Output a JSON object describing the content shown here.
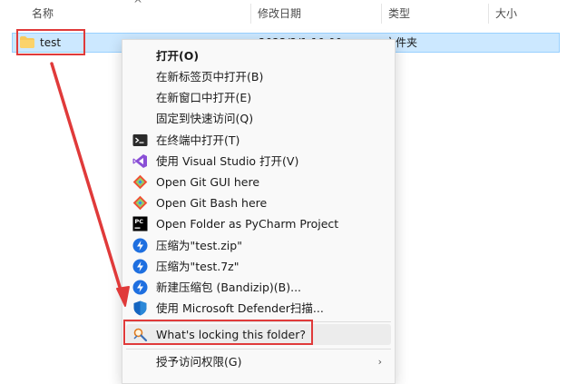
{
  "columns": {
    "name": "名称",
    "modified": "修改日期",
    "type": "类型",
    "size": "大小"
  },
  "file": {
    "name": "test",
    "modified": "2023/2/1 10:00",
    "type": "文件夹"
  },
  "menu": {
    "items": [
      {
        "label": "打开(O)",
        "icon": "none",
        "bold": true
      },
      {
        "label": "在新标签页中打开(B)",
        "icon": "none"
      },
      {
        "label": "在新窗口中打开(E)",
        "icon": "none"
      },
      {
        "label": "固定到快速访问(Q)",
        "icon": "none"
      },
      {
        "label": "在终端中打开(T)",
        "icon": "terminal-icon"
      },
      {
        "label": "使用 Visual Studio 打开(V)",
        "icon": "visual-studio-icon"
      },
      {
        "label": "Open Git GUI here",
        "icon": "git-icon"
      },
      {
        "label": "Open Git Bash here",
        "icon": "git-icon"
      },
      {
        "label": "Open Folder as PyCharm Project",
        "icon": "pycharm-icon"
      },
      {
        "label": "压缩为\"test.zip\"",
        "icon": "bandizip-icon"
      },
      {
        "label": "压缩为\"test.7z\"",
        "icon": "bandizip-icon"
      },
      {
        "label": "新建压缩包 (Bandizip)(B)...",
        "icon": "bandizip-icon"
      },
      {
        "label": "使用 Microsoft Defender扫描...",
        "icon": "defender-shield-icon"
      },
      {
        "label": "What's locking this folder?",
        "icon": "lock-hunter-icon"
      },
      {
        "label": "授予访问权限(G)",
        "icon": "none",
        "submenu": true
      }
    ]
  },
  "colors": {
    "selection": "#cce8ff",
    "highlight_box": "#e03a3a",
    "folder": "#f8c95a",
    "bandizip": "#1e6fe0",
    "visual_studio": "#8a4fd6",
    "git": "#f05033"
  }
}
